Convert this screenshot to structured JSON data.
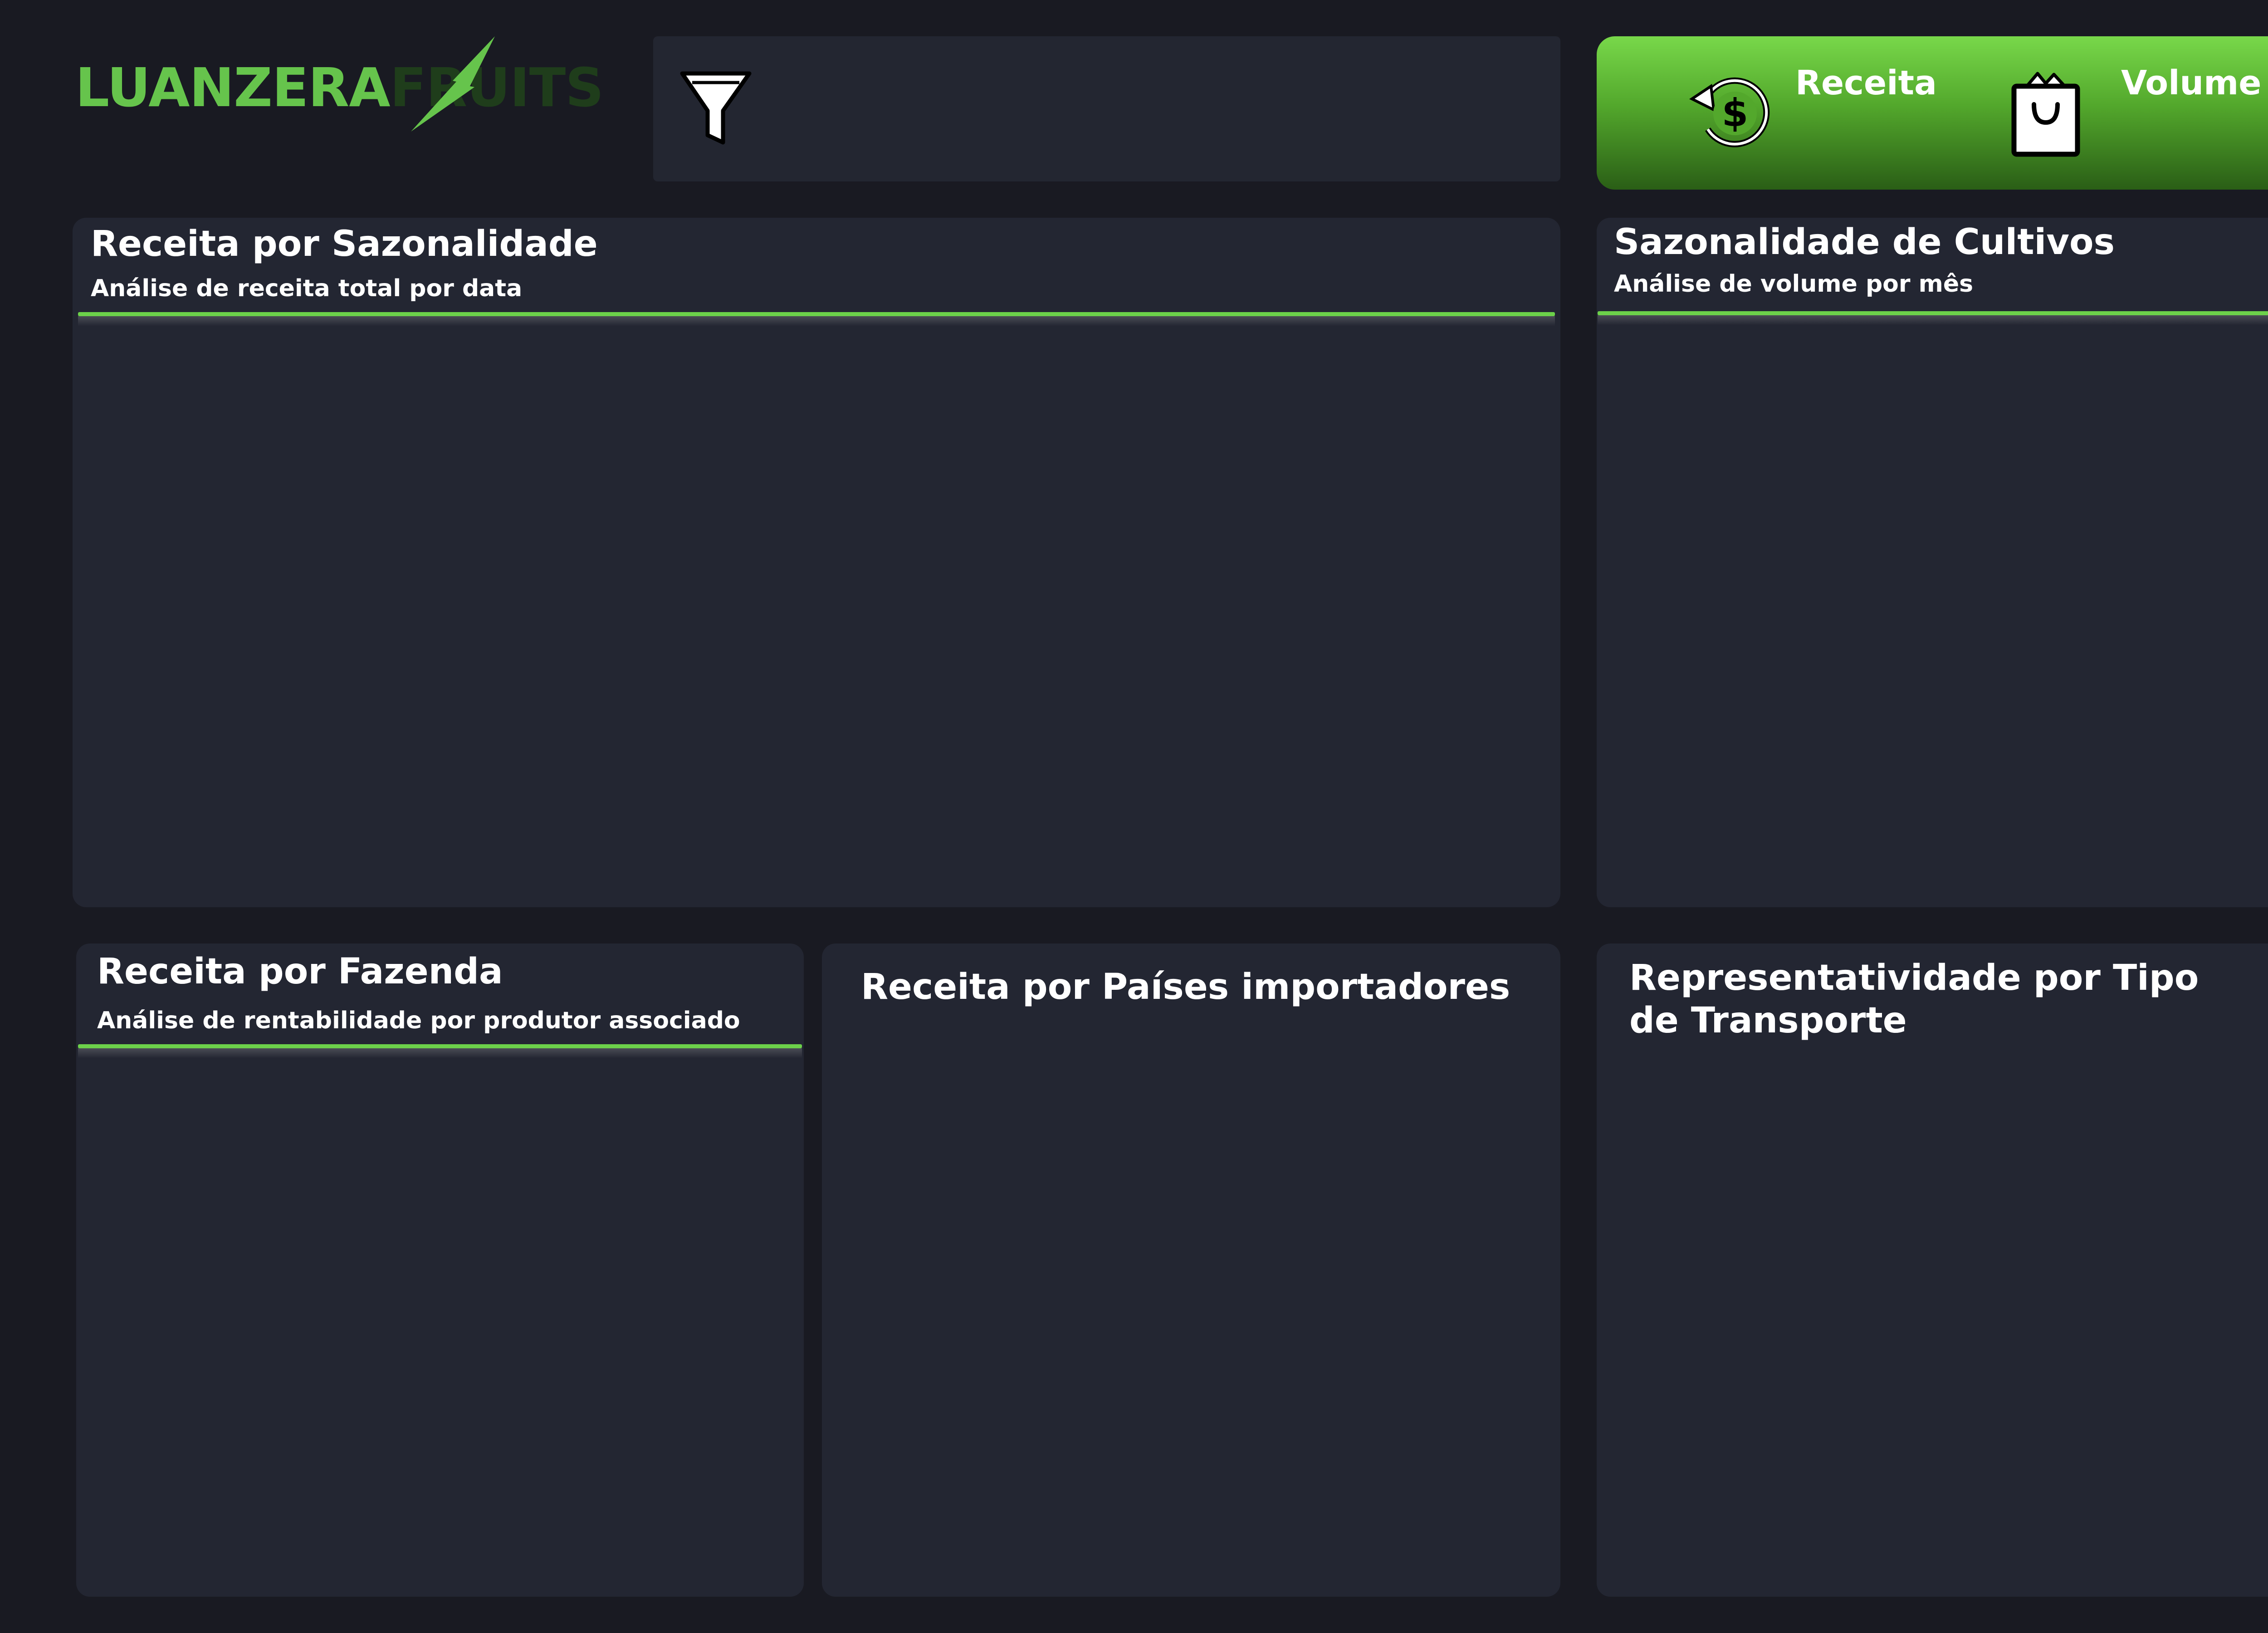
{
  "brand": {
    "name_part1": "LUANZERA",
    "name_part2": "FRUITS",
    "logo_color": "#66c44c",
    "logo_dark_color": "#1f3d1b"
  },
  "filter_bar": {
    "icon": "filter-funnel-icon"
  },
  "kpis": {
    "accent_gradient": [
      "#78d84a",
      "#2a5e16"
    ],
    "items": [
      {
        "label": "Receita",
        "icon": "dollar-refresh-icon"
      },
      {
        "label": "Volume",
        "icon": "shopping-bag-icon"
      }
    ]
  },
  "panels": {
    "revenue_seasonality": {
      "title": "Receita por Sazonalidade",
      "subtitle": "Análise de receita total por data"
    },
    "crop_seasonality": {
      "title": "Sazonalidade de Cultivos",
      "subtitle": "Análise de volume por mês"
    },
    "revenue_farm": {
      "title": "Receita por Fazenda",
      "subtitle": "Análise de rentabilidade por produtor associado"
    },
    "revenue_countries": {
      "title": "Receita por Países importadores"
    },
    "transport_share": {
      "title_line1": "Representatividade por Tipo",
      "title_line2": "de Transporte"
    }
  },
  "colors": {
    "background": "#191a22",
    "panel": "#232632",
    "accent": "#6cd14a",
    "text": "#ffffff"
  }
}
